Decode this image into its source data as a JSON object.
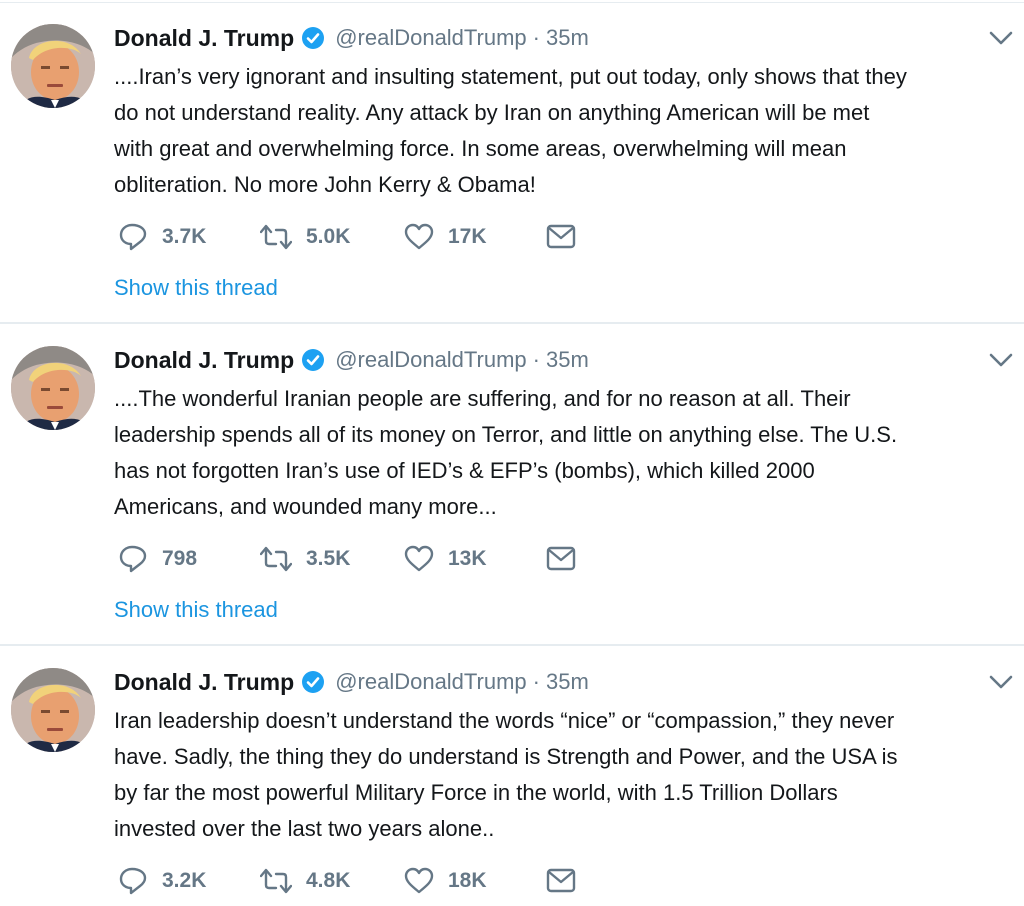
{
  "colors": {
    "text": "#14171a",
    "muted": "#657786",
    "link": "#1b95e0",
    "verified": "#1da1f2",
    "divider": "#e6ecf0"
  },
  "icons": {
    "reply": "speech-bubble-icon",
    "retweet": "retweet-arrows-icon",
    "like": "heart-icon",
    "dm": "envelope-icon",
    "verified": "verified-badge-icon",
    "caret": "chevron-down-icon"
  },
  "tweets": [
    {
      "name": "Donald J. Trump",
      "handle": "@realDonaldTrump",
      "separator": "·",
      "time": "35m",
      "lines": [
        "....Iran’s very ignorant and insulting statement, put out today, only shows that they",
        "do not understand reality. Any attack by Iran on anything American will be met",
        "with great and overwhelming force. In some areas, overwhelming will mean",
        "obliteration. No more John Kerry & Obama!"
      ],
      "replies": "3.7K",
      "retweets": "5.0K",
      "likes": "17K",
      "thread_link": "Show this thread"
    },
    {
      "name": "Donald J. Trump",
      "handle": "@realDonaldTrump",
      "separator": "·",
      "time": "35m",
      "lines": [
        "....The wonderful Iranian people are suffering, and for no reason at all. Their",
        "leadership spends all of its money on Terror, and little on anything else. The U.S.",
        "has not forgotten Iran’s use of IED’s & EFP’s (bombs), which killed 2000",
        "Americans, and wounded many more..."
      ],
      "replies": "798",
      "retweets": "3.5K",
      "likes": "13K",
      "thread_link": "Show this thread"
    },
    {
      "name": "Donald J. Trump",
      "handle": "@realDonaldTrump",
      "separator": "·",
      "time": "35m",
      "lines": [
        "Iran leadership doesn’t understand the words “nice” or “compassion,” they never",
        "have. Sadly, the thing they do understand is Strength and Power, and the USA is",
        "by far the most powerful Military Force in the world, with 1.5 Trillion Dollars",
        "invested over the last two years alone.."
      ],
      "replies": "3.2K",
      "retweets": "4.8K",
      "likes": "18K"
    }
  ]
}
